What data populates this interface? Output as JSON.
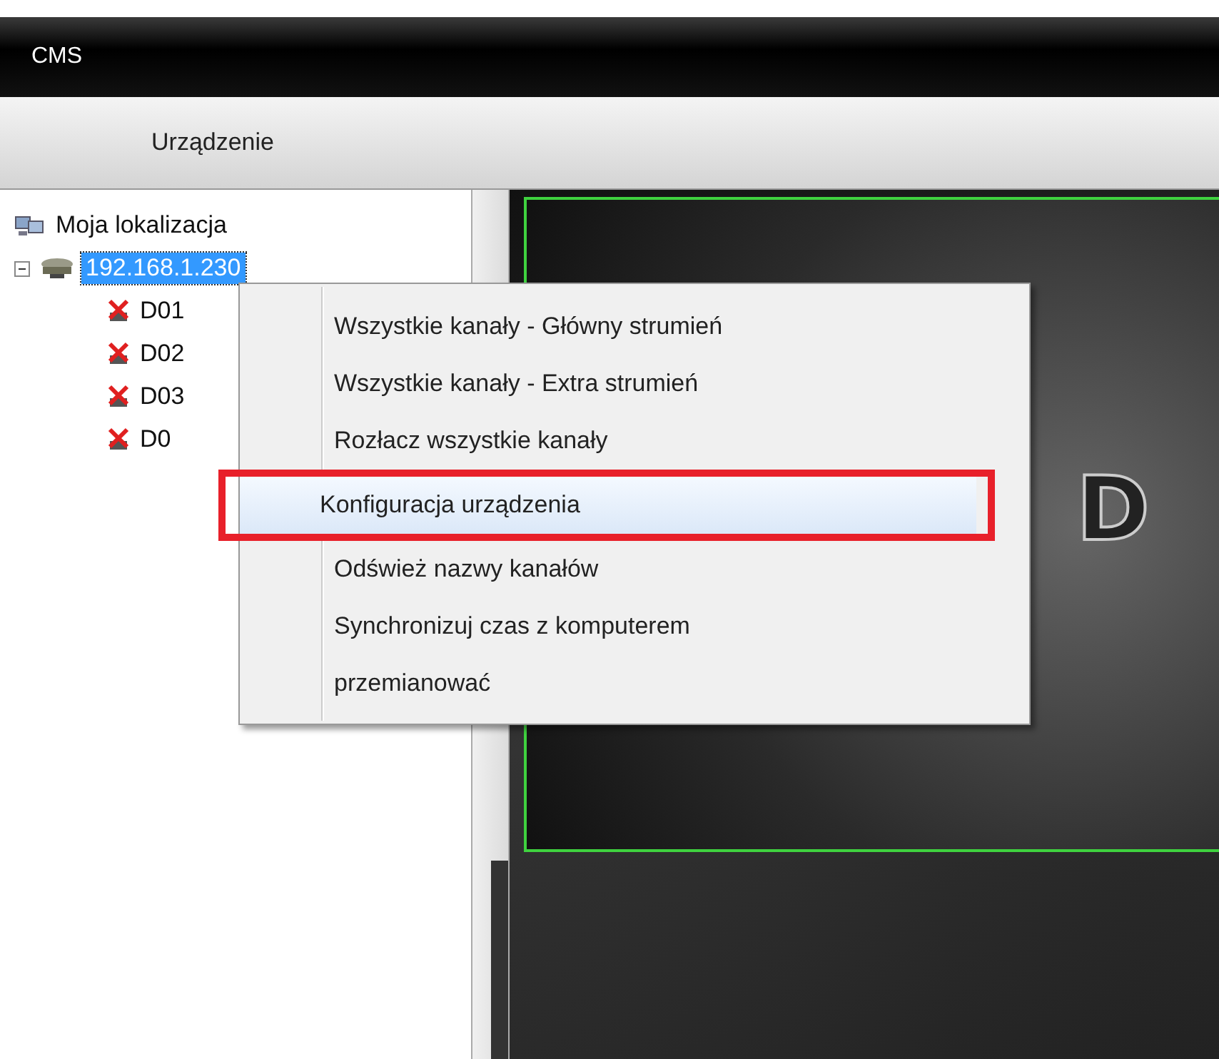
{
  "window": {
    "title": "CMS"
  },
  "tabs": [
    {
      "label": "Urządzenie",
      "selected": true
    }
  ],
  "tree": [
    {
      "label": "Moja lokalizacja",
      "kind": "location",
      "children": [
        {
          "label": "192.168.1.230",
          "kind": "device",
          "selected": true,
          "expanded": true,
          "children": [
            {
              "label": "D01",
              "kind": "channel",
              "connected": false
            },
            {
              "label": "D02",
              "kind": "channel",
              "connected": false
            },
            {
              "label": "D03",
              "kind": "channel",
              "connected": false
            },
            {
              "label": "D0",
              "kind": "channel",
              "connected": false
            }
          ]
        }
      ]
    }
  ],
  "context_menu": {
    "items": [
      {
        "label": "Wszystkie kanały - Główny strumień",
        "selected": false,
        "annotated": false
      },
      {
        "label": "Wszystkie kanały - Extra strumień",
        "selected": false,
        "annotated": false
      },
      {
        "label": "Rozłacz wszystkie kanały",
        "selected": false,
        "annotated": false
      },
      {
        "label": "Konfiguracja urządzenia",
        "selected": true,
        "annotated": true
      },
      {
        "label": "Odśwież nazwy kanałów",
        "selected": false,
        "annotated": false
      },
      {
        "label": "Synchronizuj czas z komputerem",
        "selected": false,
        "annotated": false
      },
      {
        "label": "przemianować",
        "selected": false,
        "annotated": false
      }
    ]
  },
  "video": {
    "logo_text": "D"
  }
}
